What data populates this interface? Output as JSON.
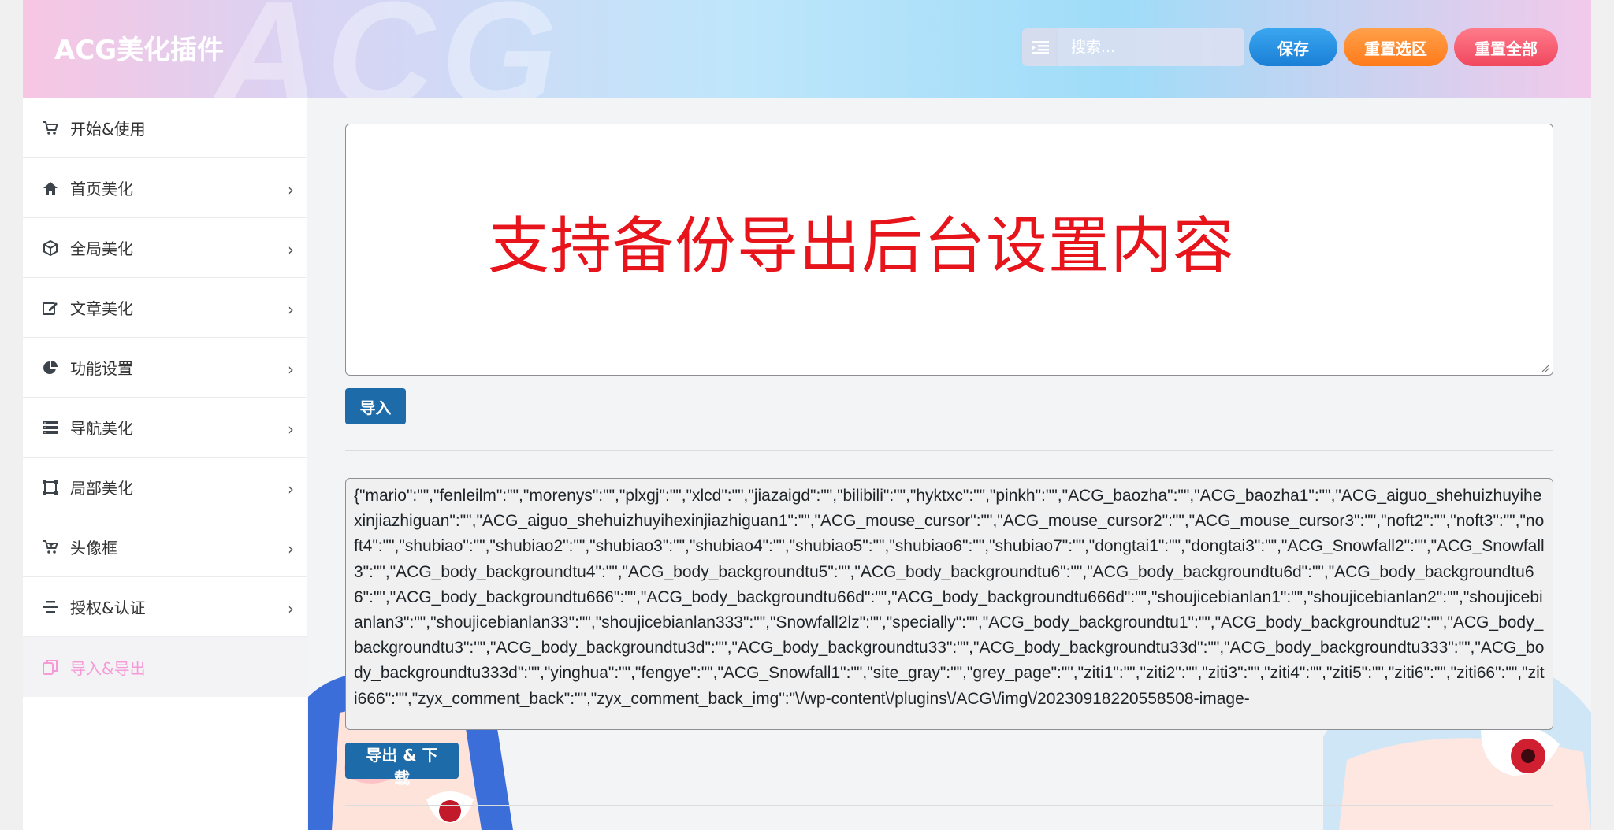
{
  "header": {
    "brand": "ACG美化插件",
    "watermark": "ACG",
    "search_placeholder": "搜索...",
    "save_label": "保存",
    "reset_selection_label": "重置选区",
    "reset_all_label": "重置全部"
  },
  "sidebar": {
    "items": [
      {
        "label": "开始&使用",
        "icon": "cart-icon"
      },
      {
        "label": "首页美化",
        "icon": "home-icon"
      },
      {
        "label": "全局美化",
        "icon": "cube-icon"
      },
      {
        "label": "文章美化",
        "icon": "edit-icon"
      },
      {
        "label": "功能设置",
        "icon": "pie-chart-icon"
      },
      {
        "label": "导航美化",
        "icon": "list-icon"
      },
      {
        "label": "局部美化",
        "icon": "crop-icon"
      },
      {
        "label": "头像框",
        "icon": "shopping-cart-icon"
      },
      {
        "label": "授权&认证",
        "icon": "align-icon"
      },
      {
        "label": "导入&导出",
        "icon": "copy-icon"
      }
    ],
    "active_index": 9
  },
  "import": {
    "note": "支持备份导出后台设置内容",
    "button_label": "导入"
  },
  "export": {
    "content": "{\"mario\":\"\",\"fenleilm\":\"\",\"morenys\":\"\",\"plxgj\":\"\",\"xlcd\":\"\",\"jiazaigd\":\"\",\"bilibili\":\"\",\"hyktxc\":\"\",\"pinkh\":\"\",\"ACG_baozha\":\"\",\"ACG_baozha1\":\"\",\"ACG_aiguo_shehuizhuyihexinjiazhiguan\":\"\",\"ACG_aiguo_shehuizhuyihexinjiazhiguan1\":\"\",\"ACG_mouse_cursor\":\"\",\"ACG_mouse_cursor2\":\"\",\"ACG_mouse_cursor3\":\"\",\"noft2\":\"\",\"noft3\":\"\",\"noft4\":\"\",\"shubiao\":\"\",\"shubiao2\":\"\",\"shubiao3\":\"\",\"shubiao4\":\"\",\"shubiao5\":\"\",\"shubiao6\":\"\",\"shubiao7\":\"\",\"dongtai1\":\"\",\"dongtai3\":\"\",\"ACG_Snowfall2\":\"\",\"ACG_Snowfall3\":\"\",\"ACG_body_backgroundtu4\":\"\",\"ACG_body_backgroundtu5\":\"\",\"ACG_body_backgroundtu6\":\"\",\"ACG_body_backgroundtu6d\":\"\",\"ACG_body_backgroundtu66\":\"\",\"ACG_body_backgroundtu666\":\"\",\"ACG_body_backgroundtu66d\":\"\",\"ACG_body_backgroundtu666d\":\"\",\"shoujicebianlan1\":\"\",\"shoujicebianlan2\":\"\",\"shoujicebianlan3\":\"\",\"shoujicebianlan33\":\"\",\"shoujicebianlan333\":\"\",\"Snowfall2lz\":\"\",\"specially\":\"\",\"ACG_body_backgroundtu1\":\"\",\"ACG_body_backgroundtu2\":\"\",\"ACG_body_backgroundtu3\":\"\",\"ACG_body_backgroundtu3d\":\"\",\"ACG_body_backgroundtu33\":\"\",\"ACG_body_backgroundtu33d\":\"\",\"ACG_body_backgroundtu333\":\"\",\"ACG_body_backgroundtu333d\":\"\",\"yinghua\":\"\",\"fengye\":\"\",\"ACG_Snowfall1\":\"\",\"site_gray\":\"\",\"grey_page\":\"\",\"ziti1\":\"\",\"ziti2\":\"\",\"ziti3\":\"\",\"ziti4\":\"\",\"ziti5\":\"\",\"ziti6\":\"\",\"ziti66\":\"\",\"ziti666\":\"\",\"zyx_comment_back\":\"\",\"zyx_comment_back_img\":\"\\/wp-content\\/plugins\\/ACG\\/img\\/20230918220558508-image-",
    "button_label": "导出 & 下载"
  },
  "colors": {
    "accent_active": "#f59ad6",
    "note_red": "#e8141b",
    "wp_blue": "#1d6ba8"
  }
}
